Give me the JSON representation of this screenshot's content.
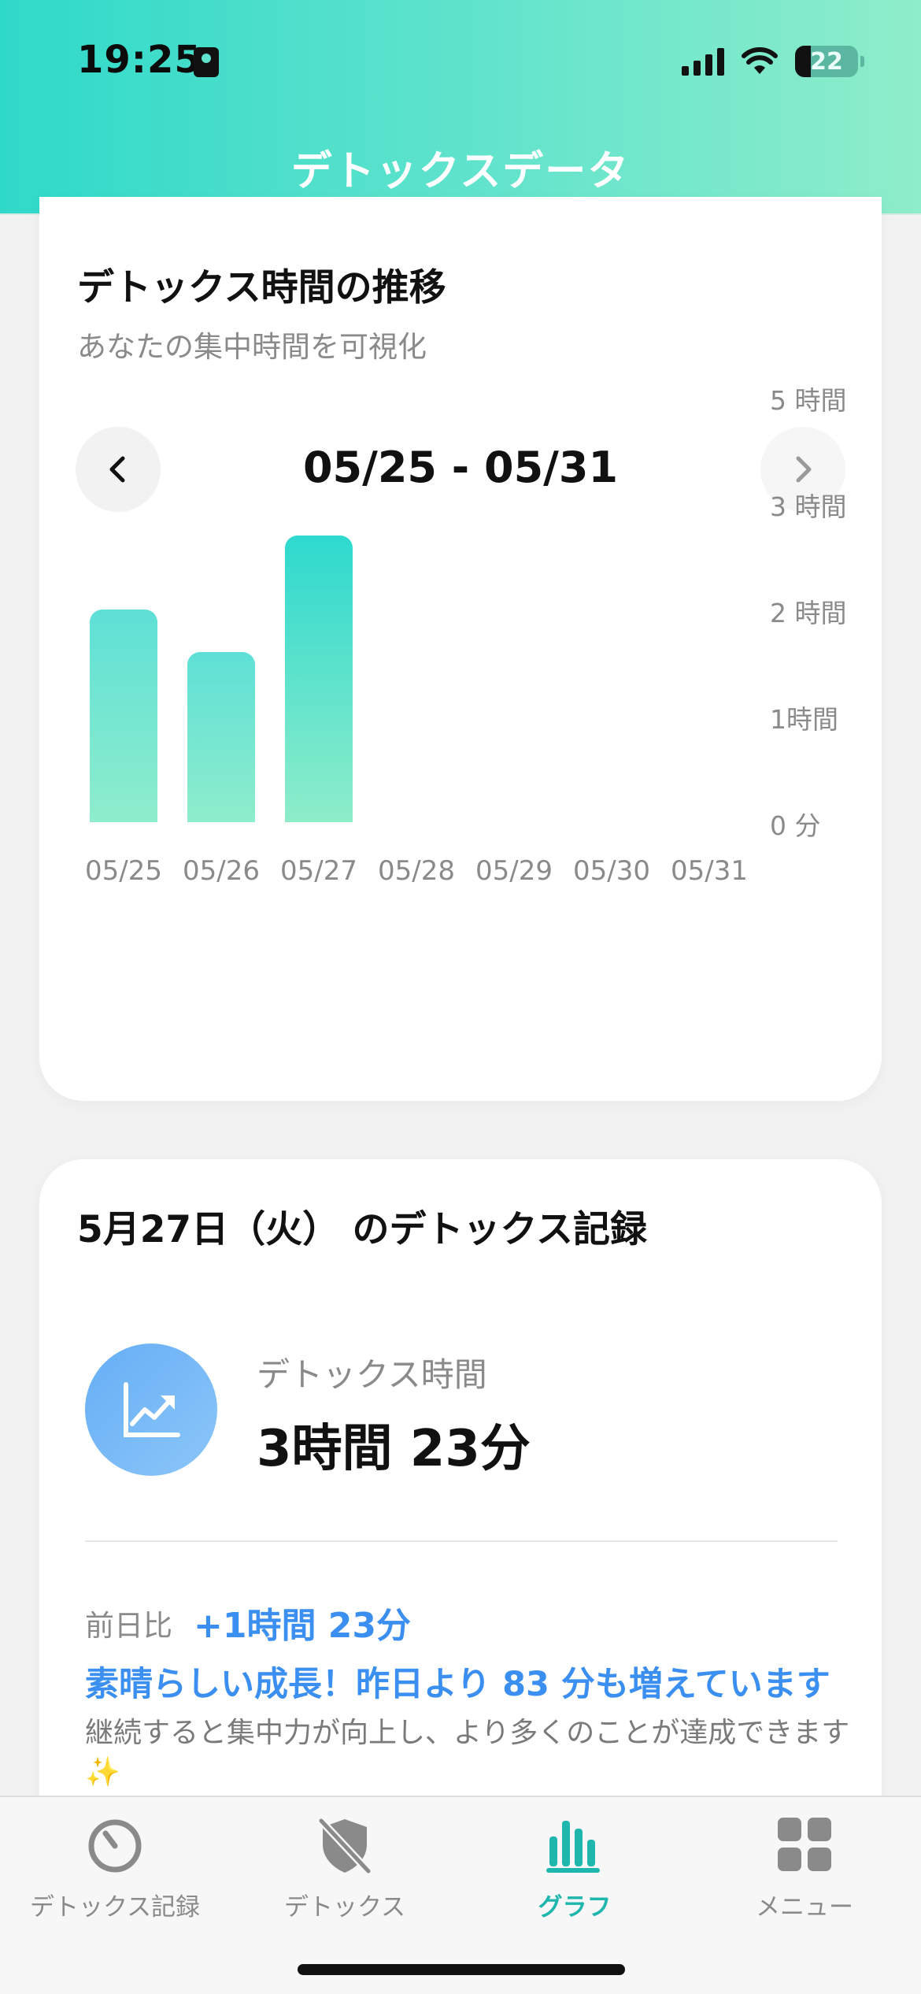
{
  "status_bar": {
    "time": "19:25",
    "battery": "22"
  },
  "header": {
    "title": "デトックスデータ"
  },
  "trend_card": {
    "title": "デトックス時間の推移",
    "subtitle": "あなたの集中時間を可視化",
    "date_range": "05/25 - 05/31",
    "prev_icon": "chevron-left-icon",
    "next_icon": "chevron-right-icon"
  },
  "chart_data": {
    "type": "bar",
    "categories": [
      "05/25",
      "05/26",
      "05/27",
      "05/28",
      "05/29",
      "05/30",
      "05/31"
    ],
    "values": [
      2.0,
      1.6,
      2.7,
      0,
      0,
      0,
      0
    ],
    "y_tick_labels": [
      "5 時間",
      "3 時間",
      "2 時間",
      "1時間",
      "0 分"
    ],
    "y_ticks": [
      4,
      3,
      2,
      1,
      0
    ],
    "ylim": [
      0,
      4
    ],
    "active_index": 2,
    "colors": {
      "bar_top": "#5ee0d6",
      "bar_bottom": "#8eedcb"
    }
  },
  "record_card": {
    "title": "5月27日（火） のデトックス記録",
    "icon": "trend-up-icon",
    "metric_label": "デトックス時間",
    "metric_value": "3時間 23分",
    "compare_label": "前日比",
    "compare_value": "+1時間 23分",
    "praise": "素晴らしい成長！昨日より 83 分も増えています",
    "note": "継続すると集中力が向上し、より多くのことが達成できます✨"
  },
  "tabbar": {
    "items": [
      {
        "label": "デトックス記録",
        "icon": "timer-icon",
        "active": false
      },
      {
        "label": "デトックス",
        "icon": "shield-off-icon",
        "active": false
      },
      {
        "label": "グラフ",
        "icon": "bar-chart-icon",
        "active": true
      },
      {
        "label": "メニュー",
        "icon": "grid-icon",
        "active": false
      }
    ]
  },
  "colors": {
    "accent": "#1eb6ad",
    "blue": "#3b8ff0",
    "header_start": "#2fd9c9",
    "header_end": "#8eedca"
  }
}
